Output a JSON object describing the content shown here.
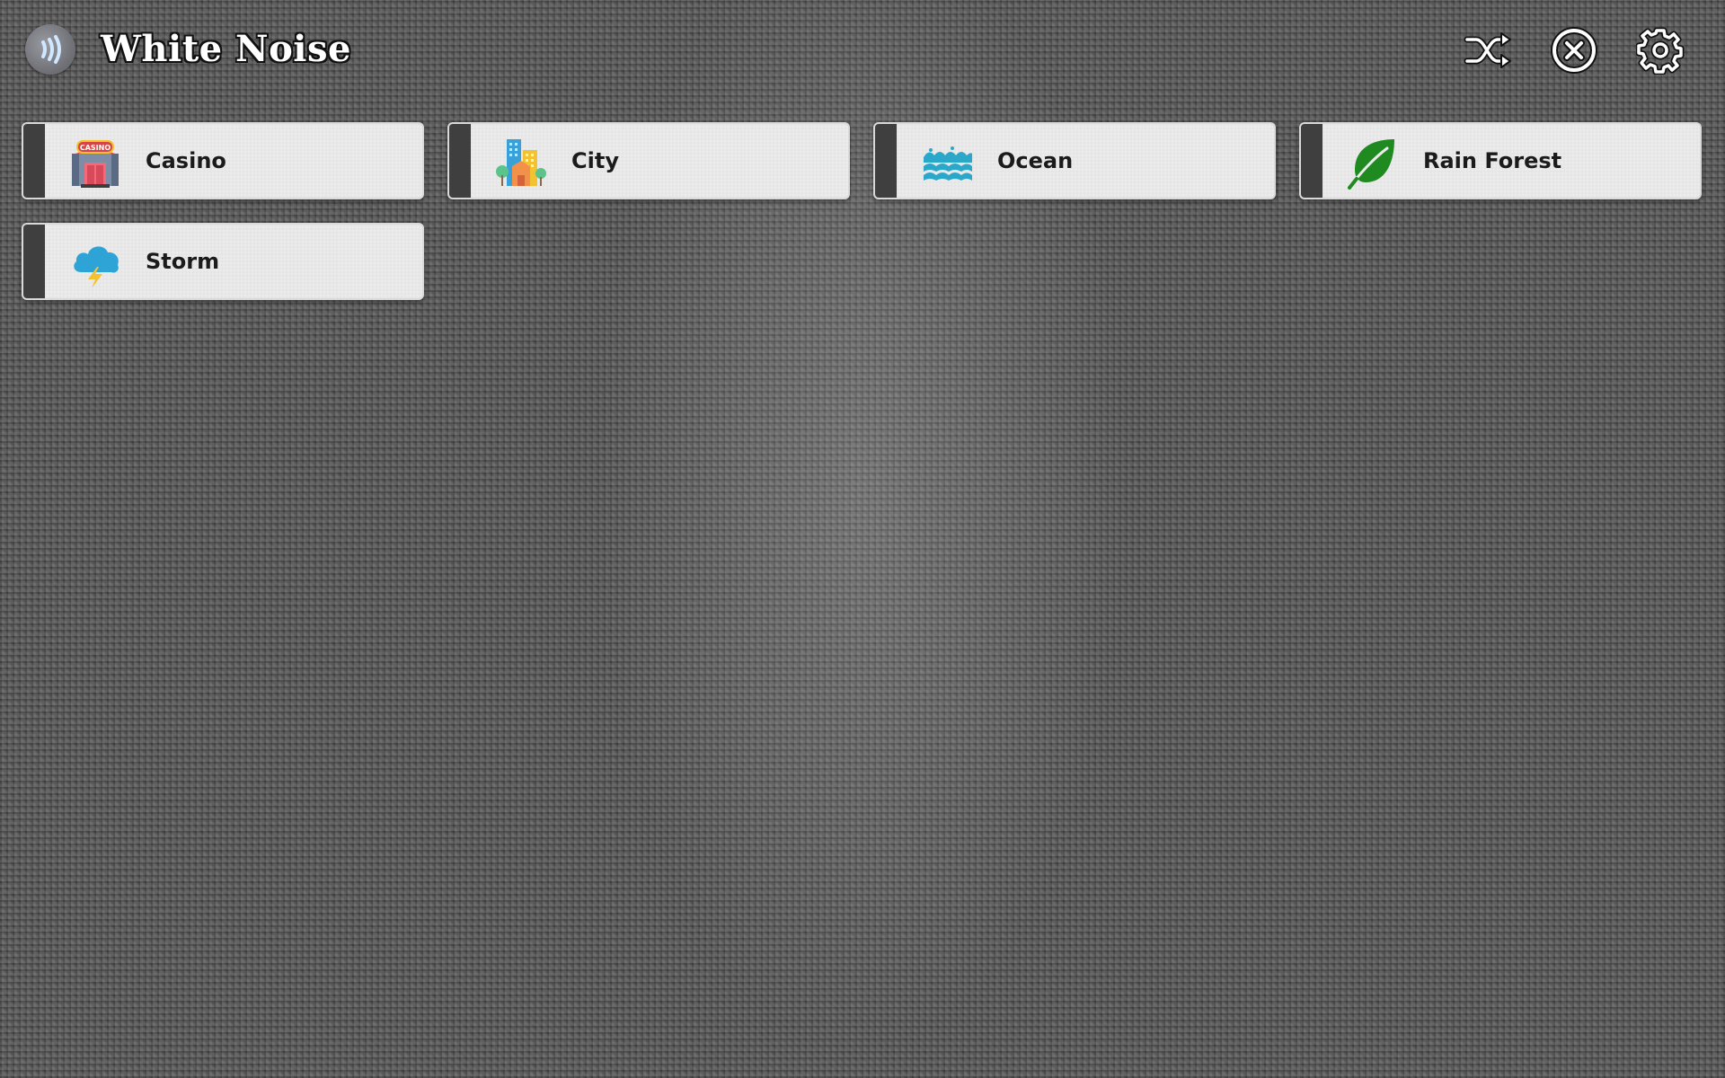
{
  "app": {
    "title": "White Noise",
    "logo_icon": "sound-waves-icon"
  },
  "toolbar": {
    "shuffle_icon": "shuffle-icon",
    "stop_icon": "close-circle-icon",
    "settings_icon": "gear-icon"
  },
  "sounds": [
    {
      "label": "Casino",
      "icon": "casino-icon",
      "icon_text": "CASINO"
    },
    {
      "label": "City",
      "icon": "city-buildings-icon"
    },
    {
      "label": "Ocean",
      "icon": "ocean-waves-icon"
    },
    {
      "label": "Rain Forest",
      "icon": "leaf-icon"
    },
    {
      "label": "Storm",
      "icon": "storm-cloud-icon"
    }
  ],
  "colors": {
    "card_background": "#ececec",
    "card_strip": "#3f3f3f",
    "leaf_green": "#1f8a1f",
    "water_blue": "#2aa7c9",
    "storm_blue": "#2ea4d6",
    "lightning_yellow": "#f2c230"
  }
}
